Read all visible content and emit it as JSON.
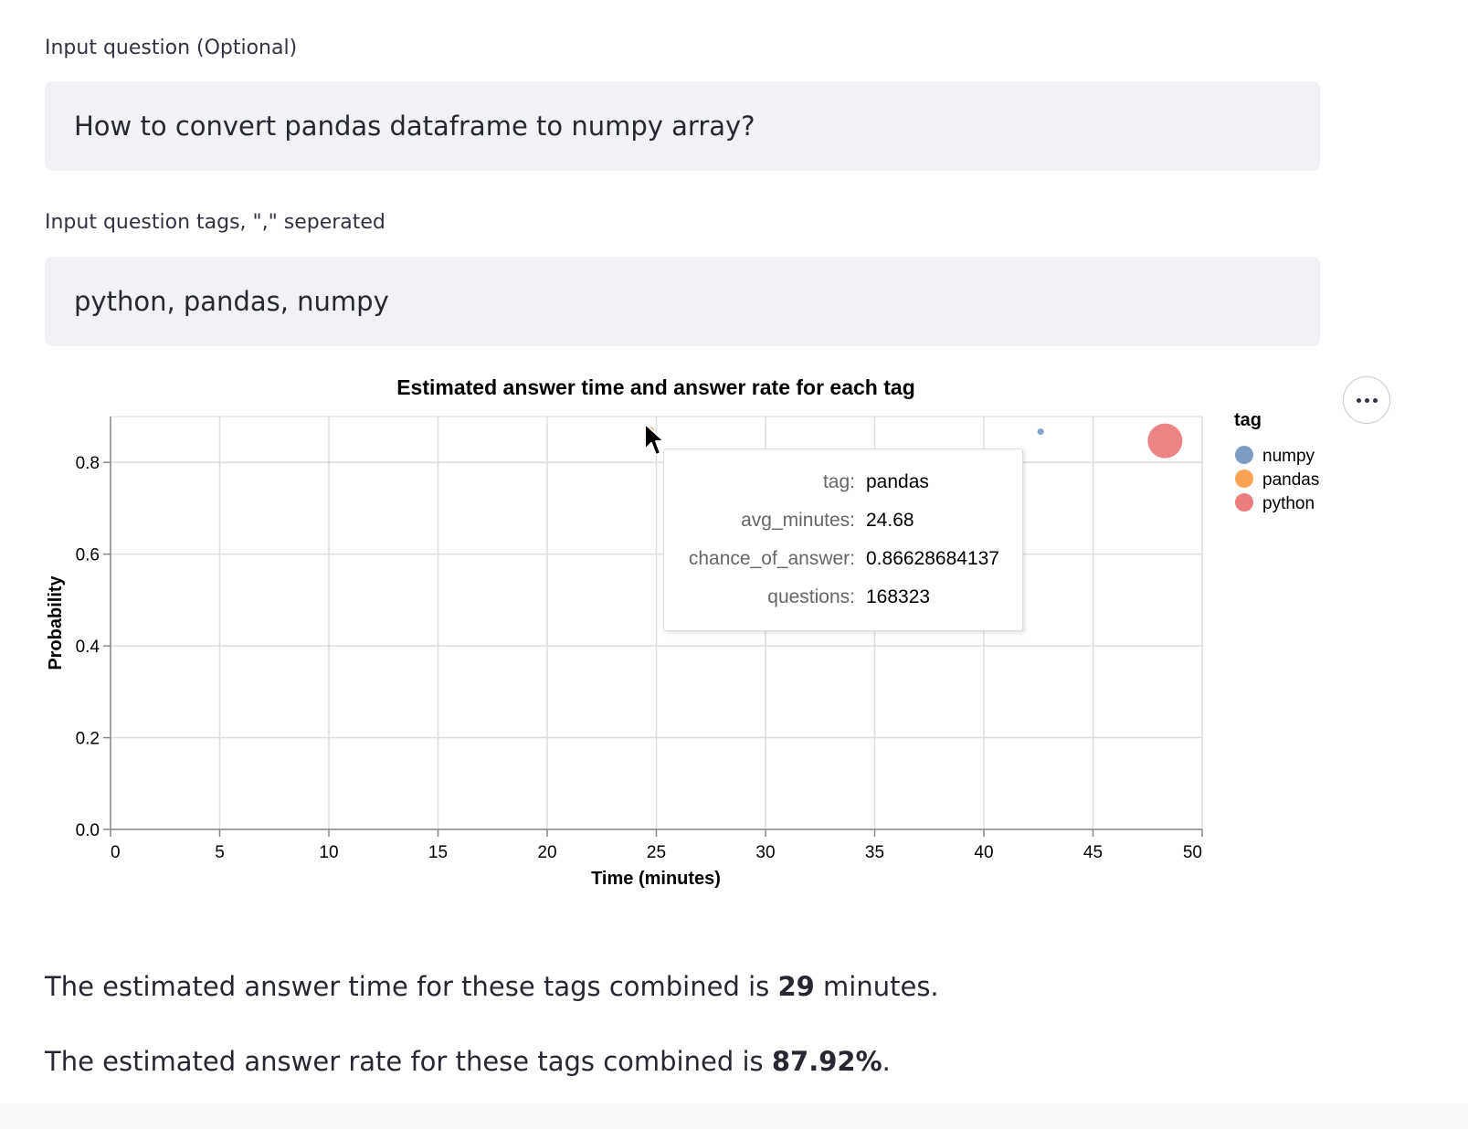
{
  "question": {
    "label": "Input question (Optional)",
    "value": "How to convert pandas dataframe to numpy array?"
  },
  "tags": {
    "label": "Input question tags, \",\" seperated",
    "value": "python, pandas, numpy"
  },
  "chart_data": {
    "type": "scatter",
    "title": "Estimated answer time and answer rate for each tag",
    "xlabel": "Time (minutes)",
    "ylabel": "Probability",
    "xlim": [
      0,
      50
    ],
    "ylim": [
      0,
      0.9
    ],
    "x_ticks": [
      0,
      5,
      10,
      15,
      20,
      25,
      30,
      35,
      40,
      45,
      50
    ],
    "y_ticks": [
      0.0,
      0.2,
      0.4,
      0.6,
      0.8
    ],
    "x_tick_labels": [
      "0",
      "5",
      "10",
      "15",
      "20",
      "25",
      "30",
      "35",
      "40",
      "45",
      "50"
    ],
    "y_tick_labels": [
      "0.0",
      "0.2",
      "0.4",
      "0.6",
      "0.8"
    ],
    "grid": true,
    "legend_title": "tag",
    "legend_position": "right",
    "size_field": "questions",
    "series": [
      {
        "name": "numpy",
        "color": "#7e9cc2",
        "x": 42.6,
        "y": 0.867,
        "questions": 3000
      },
      {
        "name": "pandas",
        "color": "#f9a354",
        "x": 24.68,
        "y": 0.86628684137,
        "questions": 168323
      },
      {
        "name": "python",
        "color": "#ea7d7f",
        "x": 48.3,
        "y": 0.847,
        "questions": 1900000
      }
    ]
  },
  "tooltip": {
    "rows": [
      {
        "key": "tag:",
        "value": "pandas"
      },
      {
        "key": "avg_minutes:",
        "value": "24.68"
      },
      {
        "key": "chance_of_answer:",
        "value": "0.86628684137"
      },
      {
        "key": "questions:",
        "value": "168323"
      }
    ]
  },
  "summary": {
    "time_prefix": "The estimated answer time for these tags combined is ",
    "time_value": "29",
    "time_suffix": " minutes.",
    "rate_prefix": "The estimated answer rate for these tags combined is ",
    "rate_value": "87.92%",
    "rate_suffix": "."
  },
  "icons": {
    "menu": "more-horizontal-icon",
    "cursor": "mouse-pointer-icon"
  }
}
